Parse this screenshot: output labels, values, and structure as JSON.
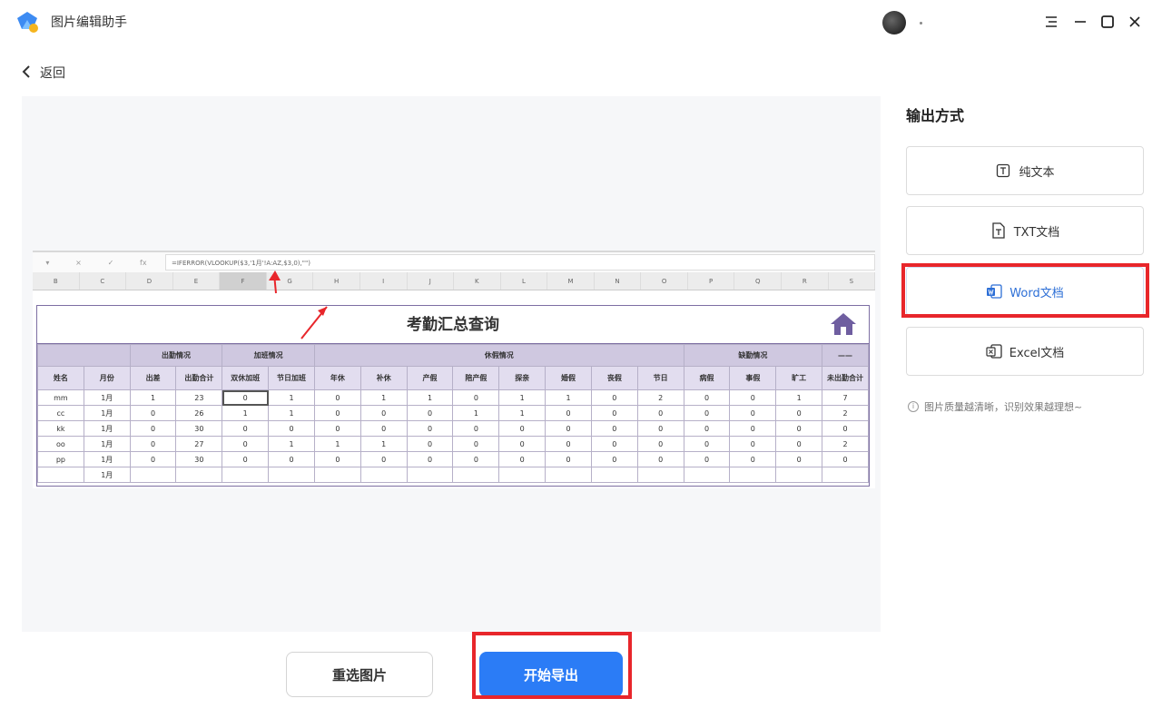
{
  "app": {
    "title": "图片编辑助手",
    "user_dot": "."
  },
  "window": {
    "menu_icon": "menu-icon",
    "min_icon": "minimize-icon",
    "max_icon": "maximize-icon",
    "close_icon": "close-icon"
  },
  "nav": {
    "back_label": "返回"
  },
  "sheet": {
    "formula": "=IFERROR(VLOOKUP($3,'1月'!A:AZ,$3,0),\"\")",
    "columns": [
      "B",
      "C",
      "D",
      "E",
      "F",
      "G",
      "H",
      "I",
      "J",
      "K",
      "L",
      "M",
      "N",
      "O",
      "P",
      "Q",
      "R",
      "S"
    ],
    "selected_column": "F",
    "table_title": "考勤汇总查询",
    "groups": [
      "出勤情况",
      "加班情况",
      "休假情况",
      "缺勤情况",
      "——"
    ],
    "headers": [
      "姓名",
      "月份",
      "出差",
      "出勤合计",
      "双休加班",
      "节日加班",
      "年休",
      "补休",
      "产假",
      "陪产假",
      "探亲",
      "婚假",
      "丧假",
      "节日",
      "病假",
      "事假",
      "旷工",
      "未出勤合计"
    ],
    "rows": [
      [
        "mm",
        "1月",
        "1",
        "23",
        "0",
        "1",
        "0",
        "1",
        "1",
        "0",
        "1",
        "1",
        "0",
        "2",
        "0",
        "0",
        "1",
        "7"
      ],
      [
        "cc",
        "1月",
        "0",
        "26",
        "1",
        "1",
        "0",
        "0",
        "0",
        "1",
        "1",
        "0",
        "0",
        "0",
        "0",
        "0",
        "0",
        "2"
      ],
      [
        "kk",
        "1月",
        "0",
        "30",
        "0",
        "0",
        "0",
        "0",
        "0",
        "0",
        "0",
        "0",
        "0",
        "0",
        "0",
        "0",
        "0",
        "0"
      ],
      [
        "oo",
        "1月",
        "0",
        "27",
        "0",
        "1",
        "1",
        "1",
        "0",
        "0",
        "0",
        "0",
        "0",
        "0",
        "0",
        "0",
        "0",
        "2"
      ],
      [
        "pp",
        "1月",
        "0",
        "30",
        "0",
        "0",
        "0",
        "0",
        "0",
        "0",
        "0",
        "0",
        "0",
        "0",
        "0",
        "0",
        "0",
        "0"
      ],
      [
        "",
        "1月",
        "",
        "",
        "",
        "",
        "",
        "",
        "",
        "",
        "",
        "",
        "",
        "",
        "",
        "",
        "",
        ""
      ]
    ]
  },
  "panel": {
    "title": "输出方式",
    "options": [
      {
        "label": "纯文本",
        "icon": "text-icon"
      },
      {
        "label": "TXT文档",
        "icon": "txt-file-icon"
      },
      {
        "label": "Word文档",
        "icon": "word-icon"
      },
      {
        "label": "Excel文档",
        "icon": "excel-icon"
      }
    ],
    "selected": "Word文档",
    "hint": "图片质量越清晰，识别效果越理想~"
  },
  "actions": {
    "reselect_label": "重选图片",
    "export_label": "开始导出"
  },
  "colors": {
    "accent": "#2b7cf6",
    "highlight": "#e8262b",
    "table_border": "#7d6fa3",
    "table_group_bg": "#cfc8e0",
    "table_header_bg": "#e2ddef"
  }
}
